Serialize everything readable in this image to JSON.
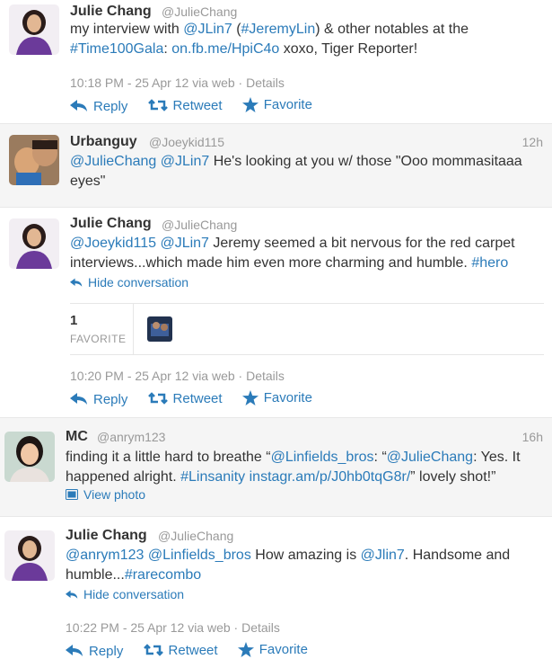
{
  "tweets": [
    {
      "name": "Julie Chang",
      "handle": "@JulieChang",
      "text": {
        "p1": "my interview with ",
        "l1": "@JLin7",
        "p2": " (",
        "l2": "#JeremyLin",
        "p3": ") & other notables at the ",
        "l3": "#Time100Gala",
        "p4": ": ",
        "l4": "on.fb.me/HpiC4o",
        "p5": " xoxo, Tiger Reporter!"
      },
      "meta": "10:18 PM - 25 Apr 12 via web · Details",
      "actions": {
        "reply": "Reply",
        "retweet": "Retweet",
        "favorite": "Favorite"
      }
    },
    {
      "name": "Urbanguy",
      "handle": "@Joeykid115",
      "time": "12h",
      "text": {
        "l1": "@JulieChang",
        "p1": " ",
        "l2": "@JLin7",
        "p2": " He's looking at you w/ those \"Ooo mommasitaaa eyes\""
      }
    },
    {
      "name": "Julie Chang",
      "handle": "@JulieChang",
      "text": {
        "l1": "@Joeykid115",
        "p1": " ",
        "l2": "@JLin7",
        "p2": " Jeremy seemed a bit nervous for the red carpet interviews...which made him even more charming and humble. ",
        "l3": "#hero"
      },
      "hide_conversation": "Hide conversation",
      "favorites": {
        "count": "1",
        "label": "FAVORITE"
      },
      "meta": "10:20 PM - 25 Apr 12 via web · Details",
      "actions": {
        "reply": "Reply",
        "retweet": "Retweet",
        "favorite": "Favorite"
      }
    },
    {
      "name": "MC",
      "handle": "@anrym123",
      "time": "16h",
      "text": {
        "p1": "finding it a little hard to breathe “",
        "l1": "@Linfields_bros",
        "p2": ": “",
        "l2": "@JulieChang",
        "p3": ": Yes. It happened alright. ",
        "l3": "#Linsanity",
        "p4": " ",
        "l4": "instagr.am/p/J0hb0tqG8r/",
        "p5": "” lovely shot!”"
      },
      "view_photo": "View photo"
    },
    {
      "name": "Julie Chang",
      "handle": "@JulieChang",
      "text": {
        "l1": "@anrym123",
        "p1": " ",
        "l2": "@Linfields_bros",
        "p2": " How amazing is ",
        "l3": "@Jlin7",
        "p3": ". Handsome and humble...",
        "l4": "#rarecombo"
      },
      "hide_conversation": "Hide conversation",
      "meta": "10:22 PM - 25 Apr 12 via web · Details",
      "actions": {
        "reply": "Reply",
        "retweet": "Retweet",
        "favorite": "Favorite"
      }
    }
  ],
  "colors": {
    "link": "#2b7bb9",
    "muted": "#999999",
    "text": "#333333"
  }
}
